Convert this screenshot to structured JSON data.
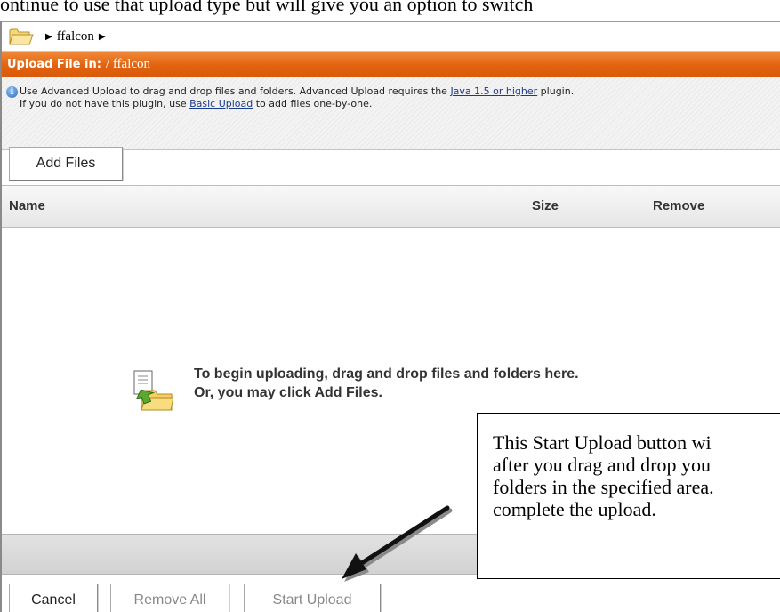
{
  "document": {
    "heading_fragment": "ontinue to use that upload type but will give you an option to switch"
  },
  "breadcrumb": {
    "folder_icon": "folder-icon",
    "separator": "▶",
    "folder": "ffalcon"
  },
  "header": {
    "label": "Upload File in:",
    "path": "/ ffalcon"
  },
  "info": {
    "icon": "info-icon",
    "line1_before_link": "Use Advanced Upload to drag and drop files and folders. Advanced Upload requires the ",
    "line1_link": "Java 1.5 or higher",
    "line1_after_link": " plugin.",
    "line2_before_link": "If you do not have this plugin, use ",
    "line2_link": "Basic Upload",
    "line2_after_link": " to add files one-by-one."
  },
  "toolbar": {
    "add_files_label": "Add Files"
  },
  "table": {
    "columns": [
      "Name",
      "Size",
      "Remove"
    ]
  },
  "drop_area": {
    "icon": "drop-files-icon",
    "line1": "To begin uploading, drag and drop files and folders here.",
    "line2": "Or, you may click Add Files."
  },
  "footer": {
    "cancel_label": "Cancel",
    "remove_all_label": "Remove All",
    "start_upload_label": "Start Upload"
  },
  "callout": {
    "lines": [
      "This Start Upload button wi",
      "after you drag and drop you",
      "folders in the specified area.",
      "complete the upload."
    ],
    "arrow_icon": "pointer-arrow-icon"
  },
  "colors": {
    "header_orange": "#e2620e",
    "link_blue": "#1a3b8c",
    "info_blue": "#2a6bc2"
  }
}
